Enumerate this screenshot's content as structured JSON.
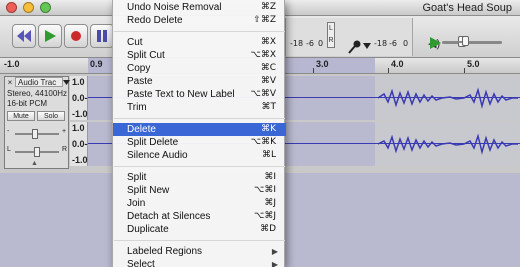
{
  "window": {
    "title": "Goat's Head Soup"
  },
  "meter": {
    "lr_left": "L",
    "lr_right": "R",
    "ticks_top": [
      "-18",
      "-6",
      "0"
    ],
    "ticks_top2": [
      "-18",
      "-6",
      "0"
    ]
  },
  "ruler": {
    "ticks": [
      {
        "label": "-1.0"
      },
      {
        "label": "0.9"
      },
      {
        "label": "3.0"
      },
      {
        "label": "4.0"
      },
      {
        "label": "5.0"
      }
    ]
  },
  "track": {
    "close": "×",
    "name": "Audio Trac",
    "info_line1": "Stereo, 44100Hz",
    "info_line2": "16-bit PCM",
    "mute_label": "Mute",
    "solo_label": "Solo",
    "gain_minus": "-",
    "gain_plus": "+",
    "pan_left": "L",
    "pan_right": "R",
    "vruler_labels": [
      "1.0",
      "0.0-",
      "-1.0",
      "1.0",
      "0.0-",
      "-1.0"
    ]
  },
  "menu": {
    "groups": [
      [
        {
          "label": "Undo Noise Removal",
          "shortcut": "⌘Z"
        },
        {
          "label": "Redo Delete",
          "shortcut": "⇧⌘Z"
        }
      ],
      [
        {
          "label": "Cut",
          "shortcut": "⌘X"
        },
        {
          "label": "Split Cut",
          "shortcut": "⌥⌘X"
        },
        {
          "label": "Copy",
          "shortcut": "⌘C"
        },
        {
          "label": "Paste",
          "shortcut": "⌘V"
        },
        {
          "label": "Paste Text to New Label",
          "shortcut": "⌥⌘V"
        },
        {
          "label": "Trim",
          "shortcut": "⌘T"
        }
      ],
      [
        {
          "label": "Delete",
          "shortcut": "⌘K",
          "highlighted": true
        },
        {
          "label": "Split Delete",
          "shortcut": "⌥⌘K"
        },
        {
          "label": "Silence Audio",
          "shortcut": "⌘L"
        }
      ],
      [
        {
          "label": "Split",
          "shortcut": "⌘I"
        },
        {
          "label": "Split New",
          "shortcut": "⌥⌘I"
        },
        {
          "label": "Join",
          "shortcut": "⌘J"
        },
        {
          "label": "Detach at Silences",
          "shortcut": "⌥⌘J"
        },
        {
          "label": "Duplicate",
          "shortcut": "⌘D"
        }
      ],
      [
        {
          "label": "Labeled Regions",
          "submenu": true
        },
        {
          "label": "Select",
          "submenu": true
        }
      ]
    ]
  },
  "colors": {
    "selection": "#b9b9cf",
    "waveform": "#3a3ab2",
    "menu_highlight": "#3a66d6"
  }
}
